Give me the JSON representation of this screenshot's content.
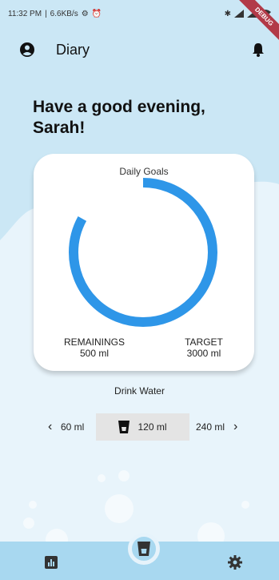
{
  "status_bar": {
    "time": "11:32 PM",
    "speed": "6.6KB/s",
    "debug_label": "DEBUG"
  },
  "app_bar": {
    "title": "Diary"
  },
  "greeting": "Have a good evening, Sarah!",
  "daily_goals": {
    "title": "Daily Goals",
    "progress_fraction": 0.83,
    "remaining_label": "REMAININGS",
    "remaining_value": "500 ml",
    "target_label": "TARGET",
    "target_value": "3000 ml",
    "ring_color": "#2e96e8"
  },
  "drink": {
    "label": "Drink Water",
    "prev_amount": "60 ml",
    "selected_amount": "120 ml",
    "next_amount": "240 ml"
  },
  "nav": {
    "left_icon": "bar-chart-icon",
    "center_icon": "cup-icon",
    "right_icon": "gear-icon"
  },
  "colors": {
    "accent": "#2e96e8",
    "background": "#cbe7f5",
    "nav": "#a8d8f0"
  }
}
